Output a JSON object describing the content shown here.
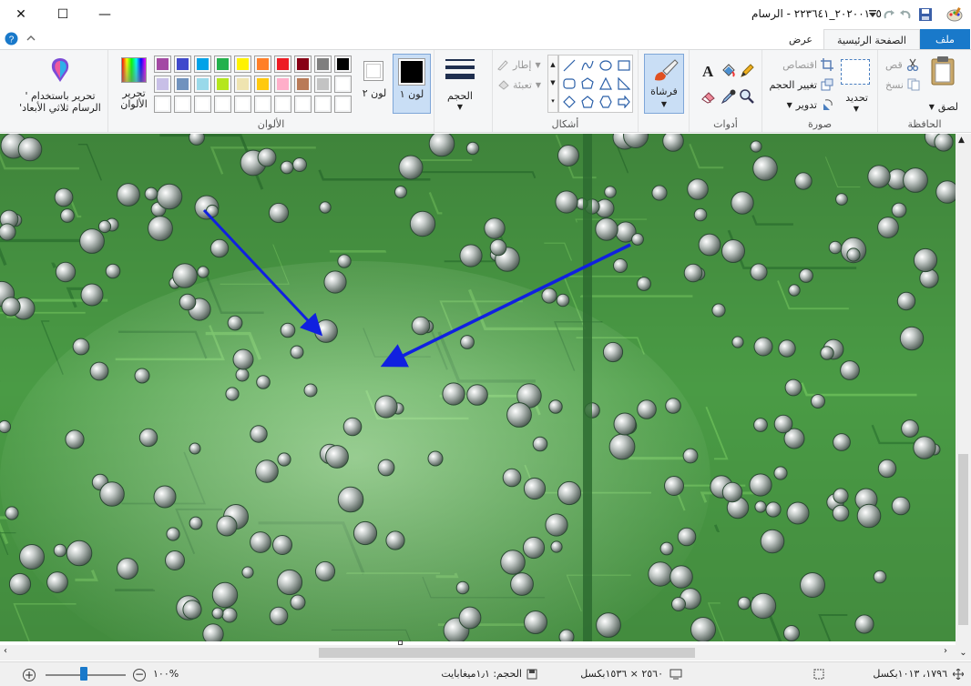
{
  "window": {
    "title": "٢٠٢٠٠١٠٥_٢٢٣٦٤١ - الرسام",
    "minimize": "—",
    "maximize": "☐",
    "close": "✕"
  },
  "tabs": {
    "file": "ملف",
    "home": "الصفحة الرئيسية",
    "view": "عرض"
  },
  "clipboard": {
    "label": "الحافظة",
    "paste": "لصق",
    "cut": "قص",
    "copy": "نسخ"
  },
  "image": {
    "label": "صورة",
    "select": "تحديد",
    "crop": "اقتصاص",
    "resize": "تغيير الحجم",
    "rotate": "تدوير"
  },
  "tools": {
    "label": "أدوات"
  },
  "brushes": {
    "label": "فرشاة"
  },
  "shapes": {
    "label": "أشكال",
    "outline": "إطار",
    "fill": "تعبئة"
  },
  "size": {
    "label": "الحجم"
  },
  "colors": {
    "label": "الألوان",
    "color1": "لون ١",
    "color2": "لون ٢",
    "edit_colors": "تحرير الألوان",
    "edit_3d": "تحرير باستخدام ' الرسام ثلاثي الأبعاد'",
    "color1_value": "#000000",
    "color2_value": "#ffffff",
    "palette_row1": [
      "#a349a4",
      "#3f48cc",
      "#00a2e8",
      "#22b14c",
      "#fff200",
      "#ff7f27",
      "#ed1c24",
      "#880015",
      "#7f7f7f",
      "#000000"
    ],
    "palette_row2": [
      "#c8bfe7",
      "#7092be",
      "#99d9ea",
      "#b5e61d",
      "#efe4b0",
      "#ffc90e",
      "#ffaec9",
      "#b97a57",
      "#c3c3c3",
      "#ffffff"
    ],
    "palette_row3": [
      "#ffffff",
      "#ffffff",
      "#ffffff",
      "#ffffff",
      "#ffffff",
      "#ffffff",
      "#ffffff",
      "#ffffff",
      "#ffffff",
      "#ffffff"
    ]
  },
  "status": {
    "cursor_pos": "١٧٩٦، ١٠١٣بكسل",
    "selection_size": "",
    "image_size": "٢٥٦٠ × ١٥٣٦بكسل",
    "file_size": "الحجم: ١٫١ميغابايت",
    "zoom": "١٠٠%"
  }
}
